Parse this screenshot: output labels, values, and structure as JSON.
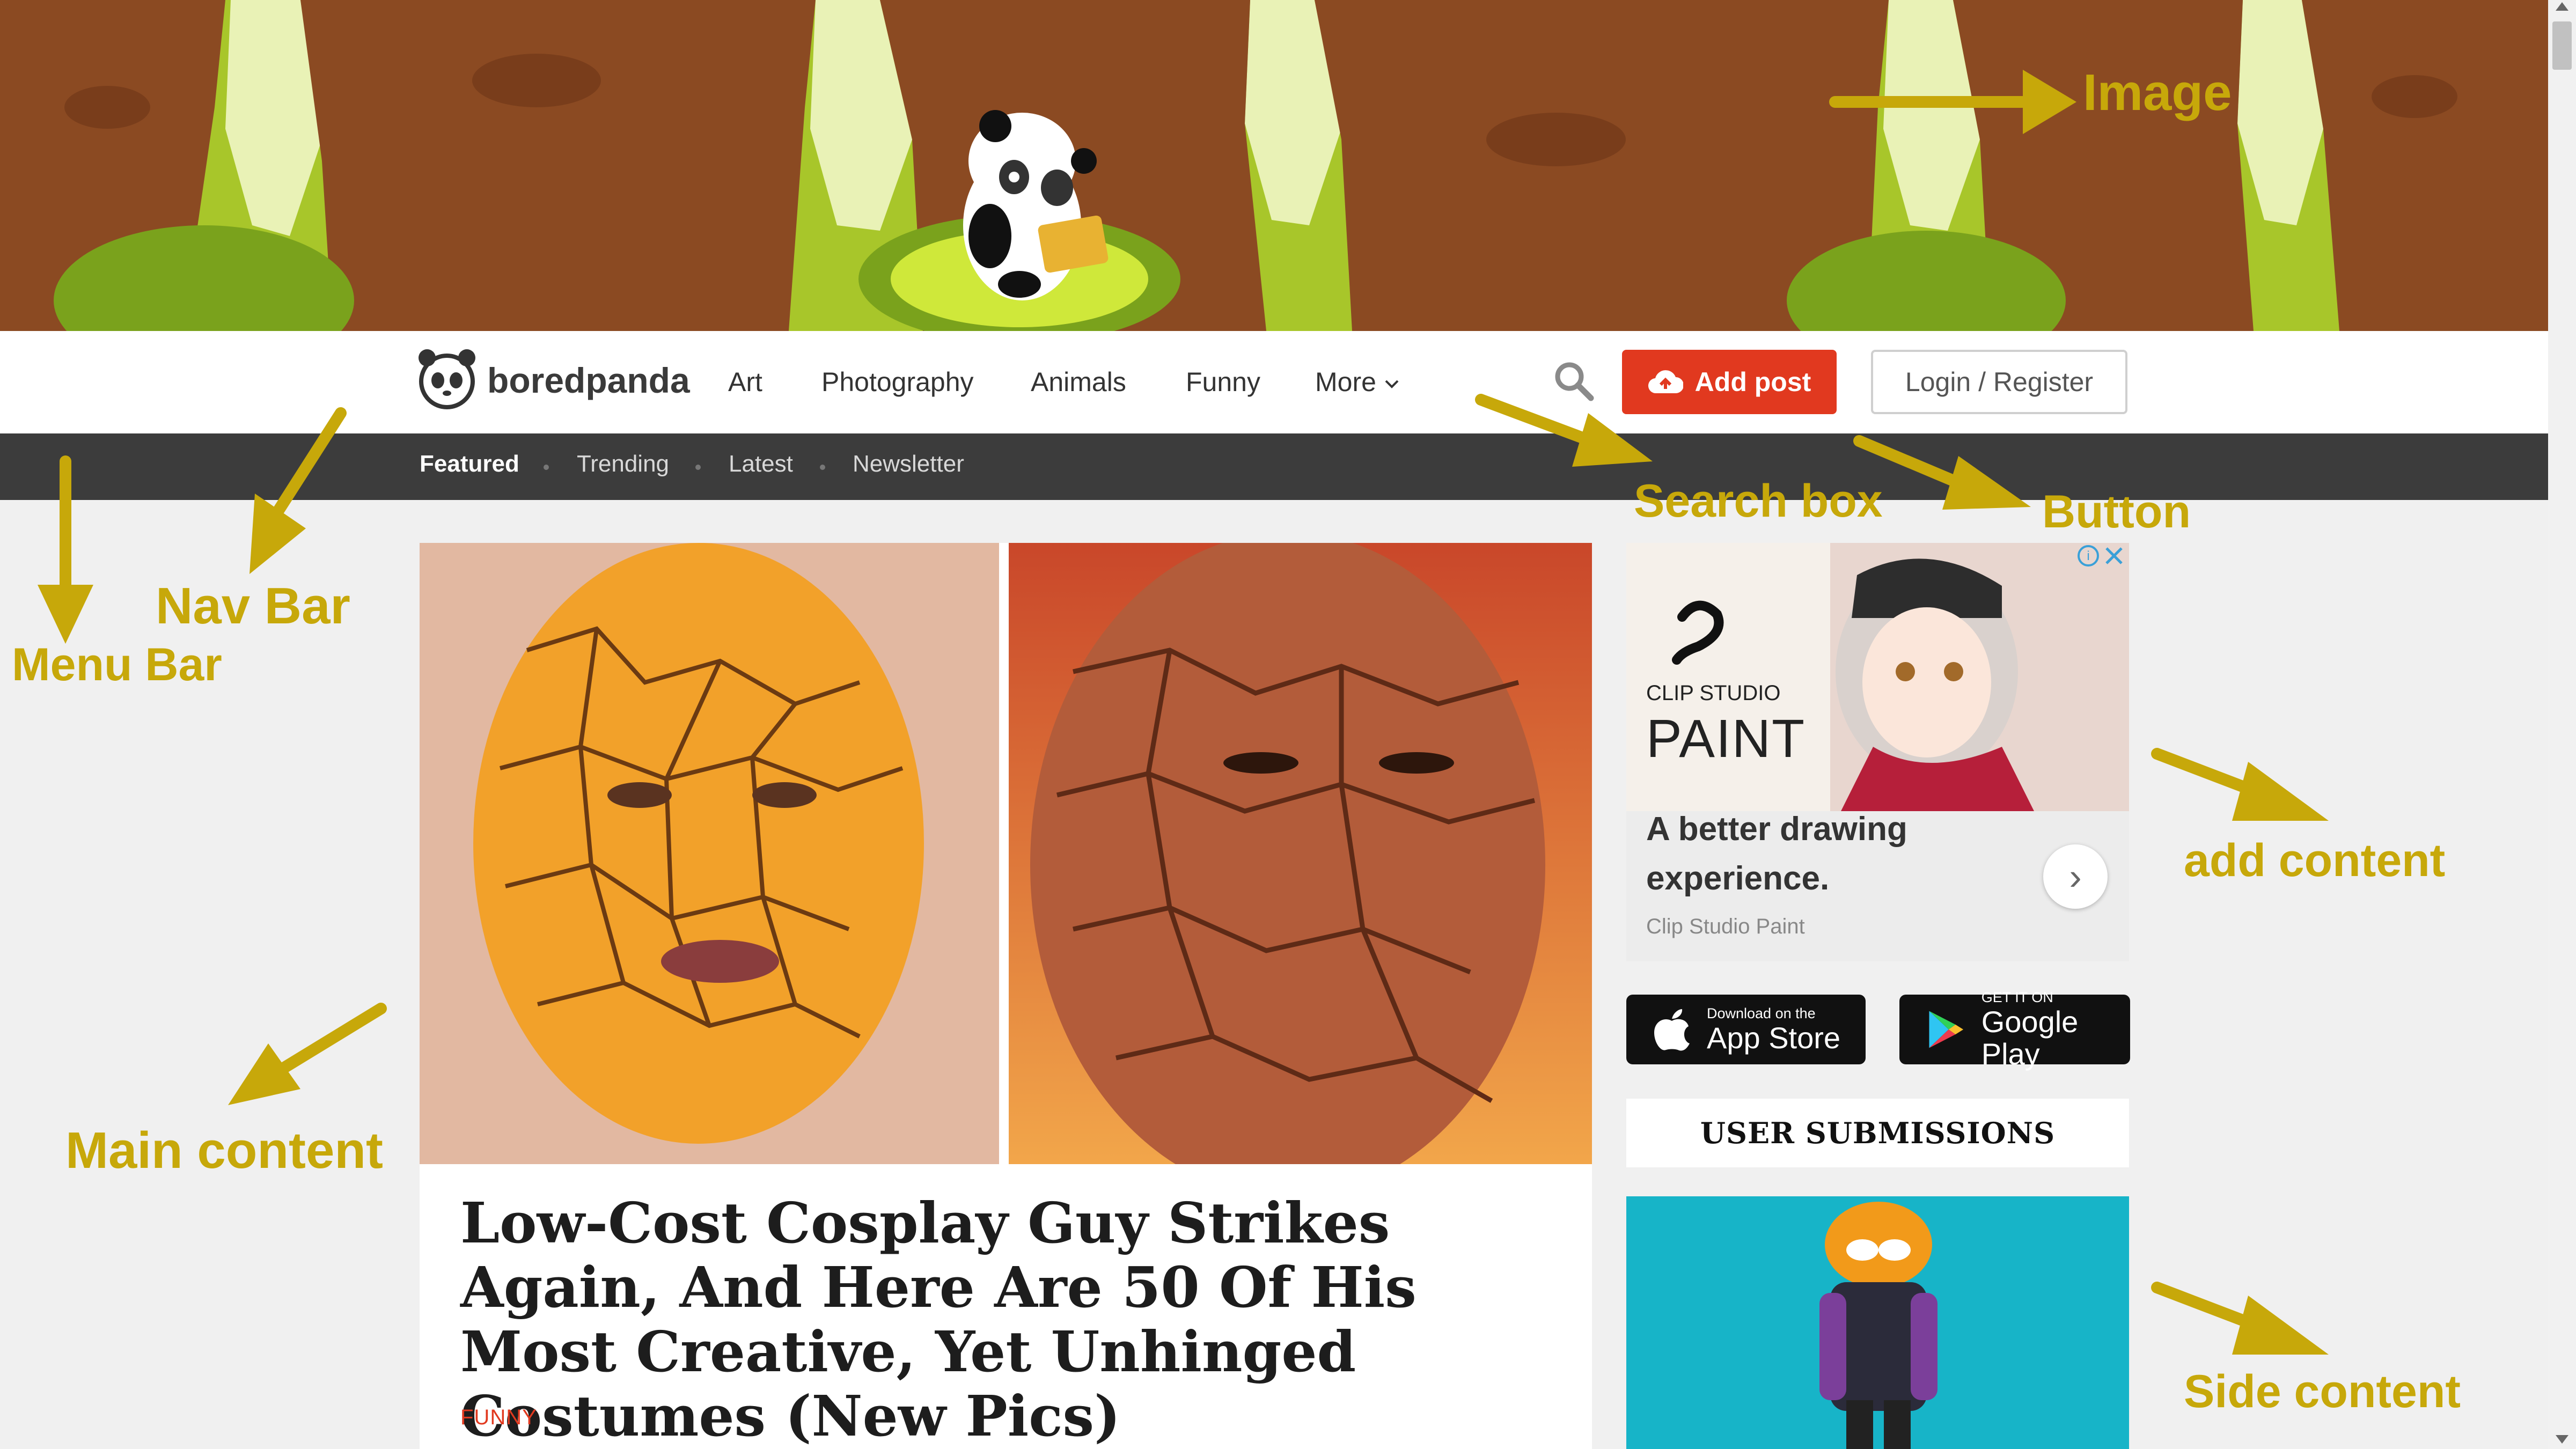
{
  "brand": {
    "name": "boredpanda"
  },
  "nav": {
    "links": [
      "Art",
      "Photography",
      "Animals",
      "Funny",
      "More"
    ],
    "add_post": "Add post",
    "login": "Login / Register"
  },
  "menu": {
    "items": [
      "Featured",
      "Trending",
      "Latest",
      "Newsletter"
    ]
  },
  "article": {
    "title": "Low-Cost Cosplay Guy Strikes Again, And Here Are 50 Of His Most Creative, Yet Unhinged Costumes (New Pics)",
    "category": "FUNNY"
  },
  "ad": {
    "brand_top": "CLIP STUDIO",
    "brand_bottom": "PAINT",
    "title": "A better drawing experience.",
    "source": "Clip Studio Paint",
    "next_glyph": "›"
  },
  "stores": {
    "appstore_small": "Download on the",
    "appstore_big": "App Store",
    "gplay_small": "GET IT ON",
    "gplay_big": "Google Play"
  },
  "sidebar": {
    "user_submissions": "USER SUBMISSIONS"
  },
  "annotations": {
    "image": "Image",
    "search_box": "Search box",
    "button": "Button",
    "nav_bar": "Nav Bar",
    "menu_bar": "Menu Bar",
    "add_content": "add content",
    "main_content": "Main content",
    "side_content": "Side content"
  },
  "colors": {
    "accent": "#e1391f",
    "annotation": "#c7a80a",
    "menubar": "#3c3c3c"
  }
}
